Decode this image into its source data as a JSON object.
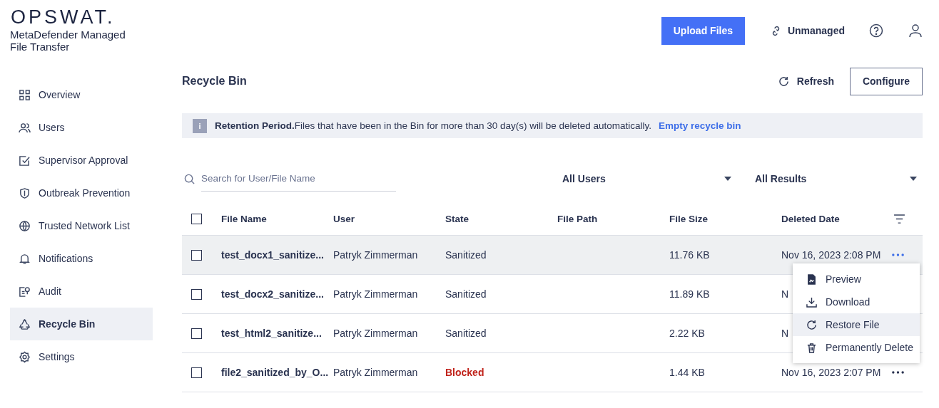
{
  "logo": "OPSWAT.",
  "product": "MetaDefender Managed\nFile Transfer",
  "header": {
    "upload": "Upload Files",
    "status": "Unmanaged"
  },
  "sidebar": {
    "items": [
      {
        "label": "Overview",
        "selected": false
      },
      {
        "label": "Users",
        "selected": false
      },
      {
        "label": "Supervisor Approval",
        "selected": false
      },
      {
        "label": "Outbreak Prevention",
        "selected": false
      },
      {
        "label": "Trusted Network List",
        "selected": false
      },
      {
        "label": "Notifications",
        "selected": false
      },
      {
        "label": "Audit",
        "selected": false
      },
      {
        "label": "Recycle Bin",
        "selected": true
      },
      {
        "label": "Settings",
        "selected": false
      }
    ]
  },
  "page": {
    "title": "Recycle Bin",
    "refresh": "Refresh",
    "configure": "Configure"
  },
  "notice": {
    "icon": "i",
    "title": "Retention Period.",
    "text": "Files that have been in the Bin for more than 30 day(s) will be deleted automatically.",
    "link": "Empty recycle bin"
  },
  "filters": {
    "search_placeholder": "Search for User/File Name",
    "users": "All Users",
    "results": "All Results"
  },
  "table": {
    "all_checked": false,
    "columns": [
      "File Name",
      "User",
      "State",
      "File Path",
      "File Size",
      "Deleted Date"
    ],
    "rows": [
      {
        "checked": false,
        "highlighted": true,
        "file": "test_docx1_sanitize...",
        "user": "Patryk Zimmerman",
        "state": "Sanitized",
        "blocked": false,
        "size": "11.76 KB",
        "date": "Nov 16, 2023 2:08 PM",
        "more": true
      },
      {
        "checked": false,
        "highlighted": false,
        "file": "test_docx2_sanitize...",
        "user": "Patryk Zimmerman",
        "state": "Sanitized",
        "blocked": false,
        "size": "11.89 KB",
        "date": "N",
        "more": false
      },
      {
        "checked": false,
        "highlighted": false,
        "file": "test_html2_sanitize...",
        "user": "Patryk Zimmerman",
        "state": "Sanitized",
        "blocked": false,
        "size": "2.22 KB",
        "date": "N",
        "more": false
      },
      {
        "checked": false,
        "highlighted": false,
        "file": "file2_sanitized_by_O...",
        "user": "Patryk Zimmerman",
        "state": "Blocked",
        "blocked": true,
        "size": "1.44 KB",
        "date": "Nov 16, 2023 2:07 PM",
        "more": true
      }
    ]
  },
  "menu": {
    "items": [
      {
        "label": "Preview",
        "selected": false
      },
      {
        "label": "Download",
        "selected": false
      },
      {
        "label": "Restore File",
        "selected": true
      },
      {
        "label": "Permanently Delete",
        "selected": false
      }
    ]
  }
}
